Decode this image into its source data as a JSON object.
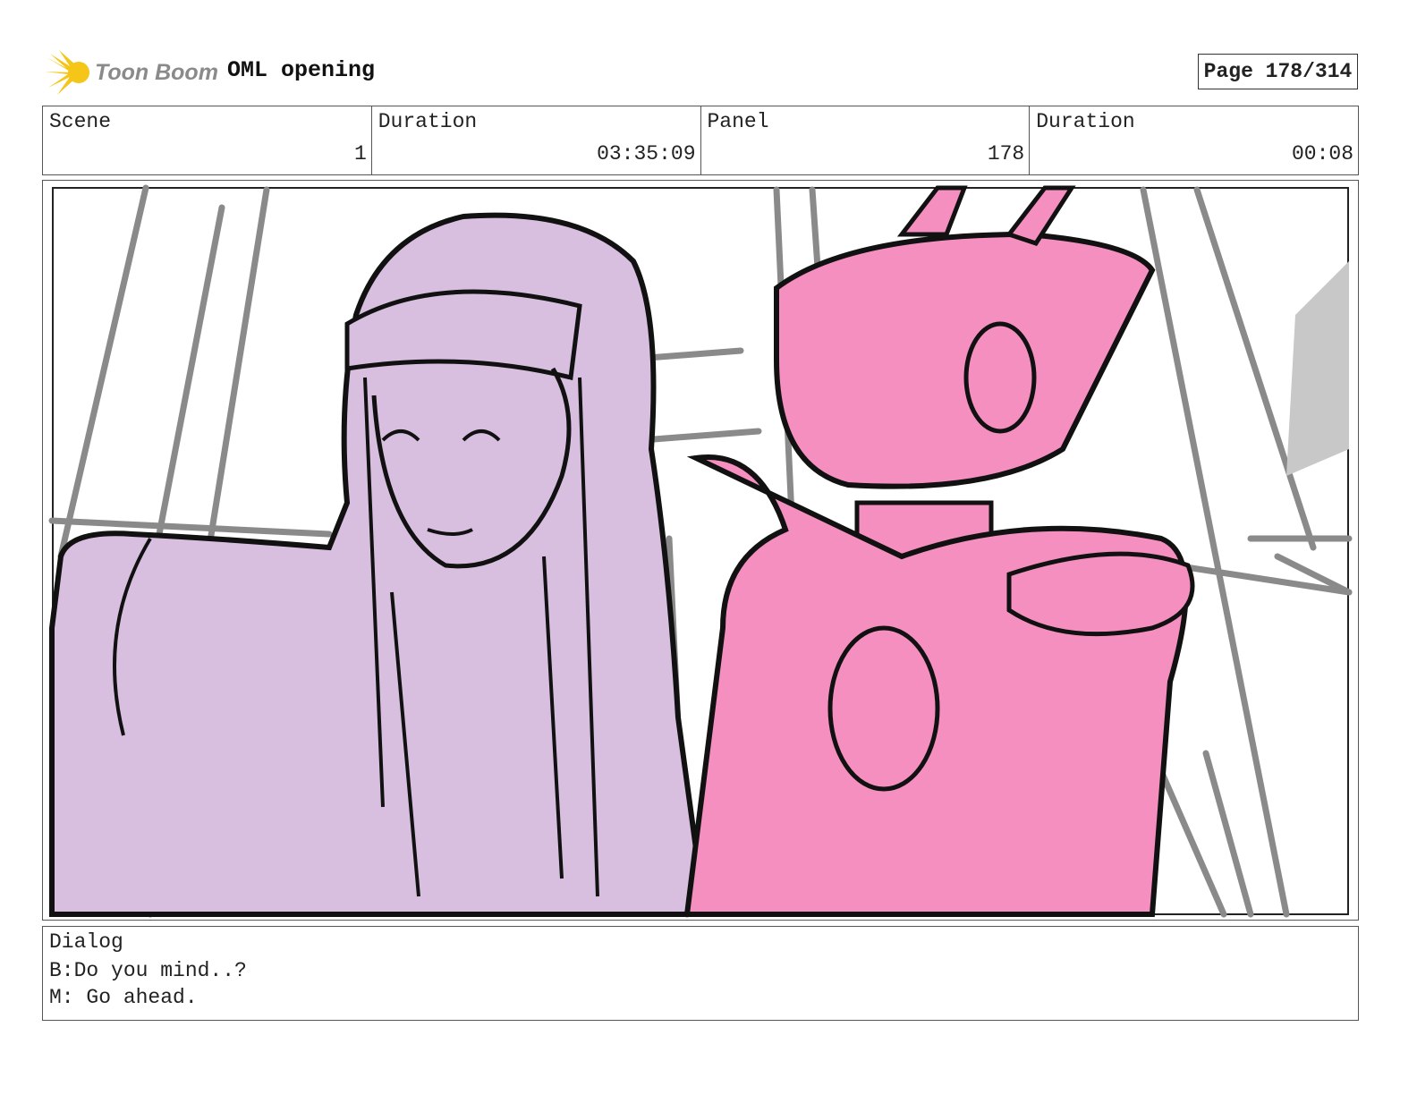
{
  "header": {
    "logo_text": "Toon Boom",
    "project_title": "OML opening",
    "page_label": "Page 178/314"
  },
  "info": [
    {
      "label": "Scene",
      "value": "1"
    },
    {
      "label": "Duration",
      "value": "03:35:09"
    },
    {
      "label": "Panel",
      "value": "178"
    },
    {
      "label": "Duration",
      "value": "00:08"
    }
  ],
  "colors": {
    "girl_fill": "#d8bfe0",
    "robot_fill": "#f48fbf",
    "line": "#111111",
    "background_sketch": "#8a8a8a",
    "logo_flame": "#f5c518"
  },
  "dialog": {
    "label": "Dialog",
    "lines": [
      "B:Do you mind..?",
      "M: Go ahead."
    ]
  }
}
